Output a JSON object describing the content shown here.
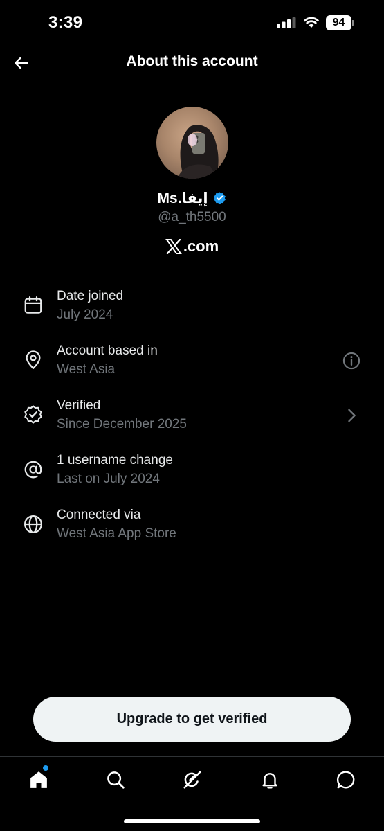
{
  "status_bar": {
    "time": "3:39",
    "battery": "94"
  },
  "header": {
    "title": "About this account"
  },
  "profile": {
    "display_name": "Ms.إيفا",
    "handle": "@a_th5500",
    "domain_text": ".com",
    "verified_color": "#1d9bf0"
  },
  "info": [
    {
      "icon": "calendar-icon",
      "title": "Date joined",
      "sub": "July 2024"
    },
    {
      "icon": "location-pin-icon",
      "title": "Account based in",
      "sub": "West Asia",
      "trail": "info-icon"
    },
    {
      "icon": "verified-seal-icon",
      "title": "Verified",
      "sub": "Since December 2025",
      "trail": "chevron-right-icon"
    },
    {
      "icon": "at-sign-icon",
      "title": "1 username change",
      "sub": "Last on July 2024"
    },
    {
      "icon": "globe-icon",
      "title": "Connected via",
      "sub": "West Asia App Store"
    }
  ],
  "upgrade": {
    "label": "Upgrade to get verified"
  },
  "tabs": [
    "home-icon",
    "search-icon",
    "grok-icon",
    "notifications-icon",
    "messages-icon"
  ],
  "colors": {
    "background": "#000000",
    "text": "#e7e9ea",
    "secondary": "#71767b",
    "accent": "#1d9bf0",
    "button": "#eff3f4"
  }
}
